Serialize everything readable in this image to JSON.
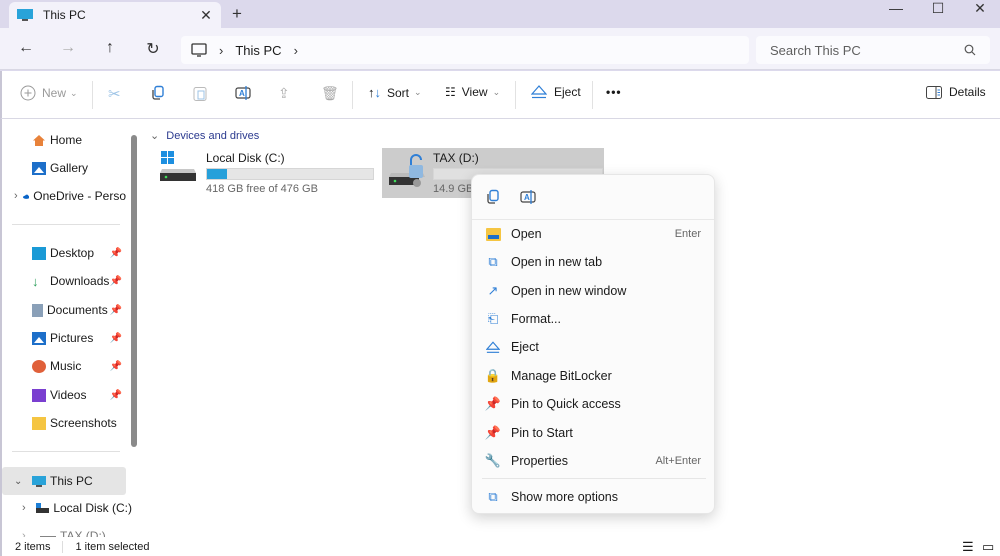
{
  "window": {
    "tab_title": "This PC",
    "tab_close": "✕",
    "new_tab": "+",
    "minimize": "—",
    "maximize": "☐",
    "close": "✕"
  },
  "nav": {
    "back": "←",
    "forward": "→",
    "up": "↑",
    "refresh": "↻",
    "breadcrumb": [
      "This PC"
    ],
    "search_placeholder": "Search This PC"
  },
  "toolbar": {
    "new_label": "New",
    "sort_label": "Sort",
    "view_label": "View",
    "eject_label": "Eject",
    "more_label": "•••",
    "details_label": "Details"
  },
  "sidebar": {
    "items": [
      {
        "label": "Home",
        "icon": "home-icon"
      },
      {
        "label": "Gallery",
        "icon": "gallery-icon"
      },
      {
        "label": "OneDrive - Perso",
        "icon": "onedrive-icon"
      },
      {
        "label": "Desktop",
        "icon": "desktop-icon",
        "pinned": true
      },
      {
        "label": "Downloads",
        "icon": "downloads-icon",
        "pinned": true
      },
      {
        "label": "Documents",
        "icon": "documents-icon",
        "pinned": true
      },
      {
        "label": "Pictures",
        "icon": "pictures-icon",
        "pinned": true
      },
      {
        "label": "Music",
        "icon": "music-icon",
        "pinned": true
      },
      {
        "label": "Videos",
        "icon": "videos-icon",
        "pinned": true
      },
      {
        "label": "Screenshots",
        "icon": "folder-icon"
      },
      {
        "label": "This PC",
        "icon": "this-pc-icon",
        "selected": true
      },
      {
        "label": "Local Disk (C:)",
        "icon": "drive-icon"
      },
      {
        "label": "TAX (D:)",
        "icon": "drive-icon"
      }
    ]
  },
  "main": {
    "group_label": "Devices and drives",
    "drives": [
      {
        "name": "Local Disk (C:)",
        "free_text": "418 GB free of 476 GB",
        "used_percent": 12
      },
      {
        "name": "TAX (D:)",
        "free_text": "14.9 GB",
        "used_percent": 0,
        "selected": true
      }
    ]
  },
  "context_menu": {
    "items": [
      {
        "label": "Open",
        "shortcut": "Enter",
        "icon": "folder-open-icon"
      },
      {
        "label": "Open in new tab",
        "icon": "new-tab-icon"
      },
      {
        "label": "Open in new window",
        "icon": "new-window-icon"
      },
      {
        "label": "Format...",
        "icon": "format-icon"
      },
      {
        "label": "Eject",
        "icon": "eject-icon"
      },
      {
        "label": "Manage BitLocker",
        "icon": "bitlocker-icon"
      },
      {
        "label": "Pin to Quick access",
        "icon": "pin-icon"
      },
      {
        "label": "Pin to Start",
        "icon": "pin-icon"
      },
      {
        "label": "Properties",
        "shortcut": "Alt+Enter",
        "icon": "wrench-icon"
      },
      {
        "label": "Show more options",
        "icon": "more-options-icon"
      }
    ]
  },
  "status": {
    "items_count": "2 items",
    "selected_count": "1 item selected"
  }
}
